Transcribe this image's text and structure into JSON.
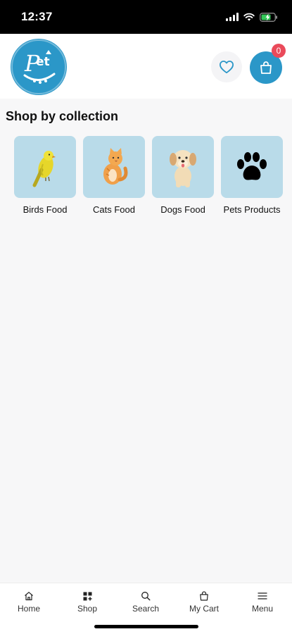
{
  "status_bar": {
    "time": "12:37"
  },
  "header": {
    "logo_text": "Pet",
    "cart_count": "0"
  },
  "section": {
    "title": "Shop by collection"
  },
  "collections": [
    {
      "label": "Birds Food",
      "icon": "bird-icon"
    },
    {
      "label": "Cats Food",
      "icon": "cat-icon"
    },
    {
      "label": "Dogs Food",
      "icon": "dog-icon"
    },
    {
      "label": "Pets Products",
      "icon": "paw-icon"
    }
  ],
  "bottom_nav": [
    {
      "label": "Home",
      "icon": "home-icon"
    },
    {
      "label": "Shop",
      "icon": "grid-icon"
    },
    {
      "label": "Search",
      "icon": "search-icon"
    },
    {
      "label": "My Cart",
      "icon": "bag-icon"
    },
    {
      "label": "Menu",
      "icon": "menu-icon"
    }
  ],
  "colors": {
    "brand": "#2b97c8",
    "tile": "#b9dbe9",
    "badge": "#ea4a5a",
    "background": "#f7f7f8"
  }
}
